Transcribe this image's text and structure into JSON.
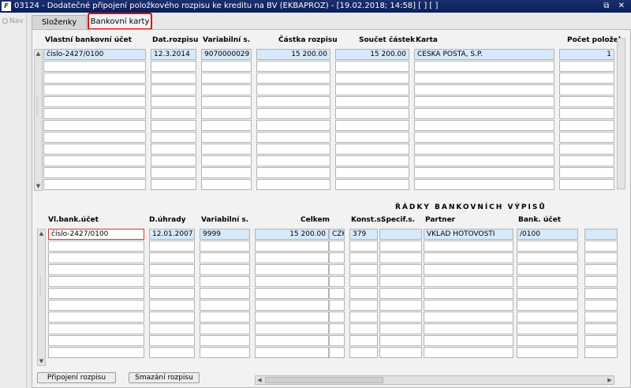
{
  "window": {
    "title": "03124 - Dodatečné připojení položkového rozpisu ke kreditu na BV (EKBAPROZ) - [19.02.2018; 14:58]  [ ]  [ ]",
    "icon_label": "F",
    "controls": "⧉ ✕"
  },
  "nav": {
    "label": "Nav"
  },
  "tabs": [
    {
      "label": "Složenky"
    },
    {
      "label": "Bankovní karty"
    }
  ],
  "top_table": {
    "headers": {
      "account": "Vlastní bankovní účet",
      "date": "Dat.rozpisu",
      "varsym": "Variabilní s.",
      "amount": "Částka rozpisu",
      "sum": "Součet částek",
      "card": "Karta",
      "count": "Počet položek"
    },
    "row": {
      "account": "číslo-2427/0100",
      "date": "12.3.2014",
      "varsym": "9070000029",
      "amount": "15 200.00",
      "sum": "15 200.00",
      "card": "CESKA POSTA, S.P.",
      "count": "1"
    }
  },
  "bottom_section": {
    "title": "ŘÁDKY BANKOVNÍCH VÝPISŮ"
  },
  "bottom_table": {
    "headers": {
      "account": "Vl.bank.účet",
      "date": "D.úhrady",
      "varsym": "Variabilní s.",
      "total": "Celkem",
      "konst": "Konst.s.",
      "specif": "Specif.s.",
      "partner": "Partner",
      "bank": "Bank. účet"
    },
    "row": {
      "account": "číslo-2427/0100",
      "date": "12.01.2007",
      "varsym": "9999",
      "total": "15 200.00",
      "currency": "CZK",
      "konst": "379",
      "specif": "",
      "partner": "VKLAD HOTOVOSTI",
      "bank": "/0100"
    }
  },
  "buttons": {
    "attach": "Připojení rozpisu",
    "delete": "Smazání rozpisu"
  }
}
